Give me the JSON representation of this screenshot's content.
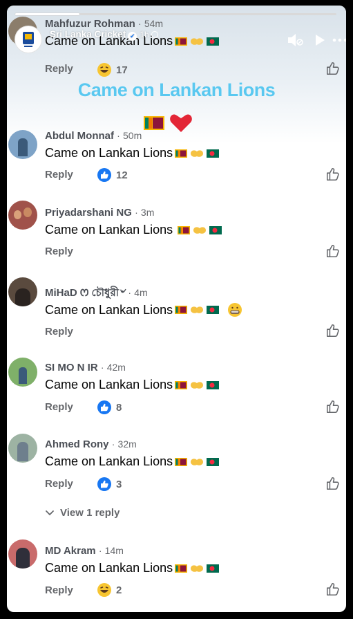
{
  "story": {
    "page_name": "Sri Lanka Cricket",
    "time": "1h",
    "progress_percent": 20,
    "overlay_text": "Came on Lankan Lions"
  },
  "comments": [
    {
      "author": "Mahfuzur Rohman",
      "time": "54m",
      "text": "Came on Lankan Lions",
      "reaction": "haha-icon",
      "count": "17"
    },
    {
      "author": "Abdul Monnaf",
      "time": "50m",
      "text": "Came on Lankan Lions",
      "reaction": "like-icon",
      "count": "12"
    },
    {
      "author": "Priyadarshani NG",
      "time": "3m",
      "text": "Came on Lankan Lions ",
      "reaction": "",
      "count": ""
    },
    {
      "author": "MiHaD ꯁ চৌধুরী৺",
      "time": "4m",
      "text": "Came on Lankan Lions",
      "reaction": "",
      "count": ""
    },
    {
      "author": "SI MO N IR",
      "time": "42m",
      "text": "Came on Lankan Lions",
      "reaction": "like-icon",
      "count": "8"
    },
    {
      "author": "Ahmed Rony",
      "time": "32m",
      "text": "Came on Lankan Lions",
      "reaction": "like-icon",
      "count": "3"
    },
    {
      "author": "MD Akram",
      "time": "14m",
      "text": "Came on Lankan Lions",
      "reaction": "haha-icon",
      "count": "2"
    }
  ],
  "labels": {
    "reply": "Reply",
    "view_replies": "View 1 reply",
    "separator": "·"
  },
  "colors": {
    "overlay_text": "#5ac8f0",
    "like_badge": "#1877f2",
    "text_primary": "#050505",
    "text_secondary": "#65676b"
  }
}
